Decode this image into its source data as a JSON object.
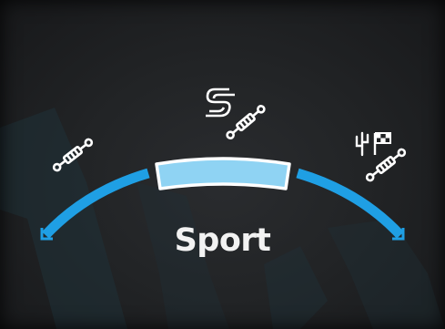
{
  "drive_mode": {
    "selected_label": "Sport",
    "segments": [
      {
        "id": "comfort",
        "active": false
      },
      {
        "id": "sport",
        "active": true
      },
      {
        "id": "off-road",
        "active": false
      }
    ],
    "icons": {
      "comfort": "suspension-comfort-icon",
      "sport": "sport-s-suspension-icon",
      "off_road": "off-road-terrain-icon"
    }
  },
  "colors": {
    "background": "#222426",
    "arc_blue": "#1f9fe4",
    "selected_fill": "#8fd3f3",
    "text": "#f2f2f2"
  }
}
